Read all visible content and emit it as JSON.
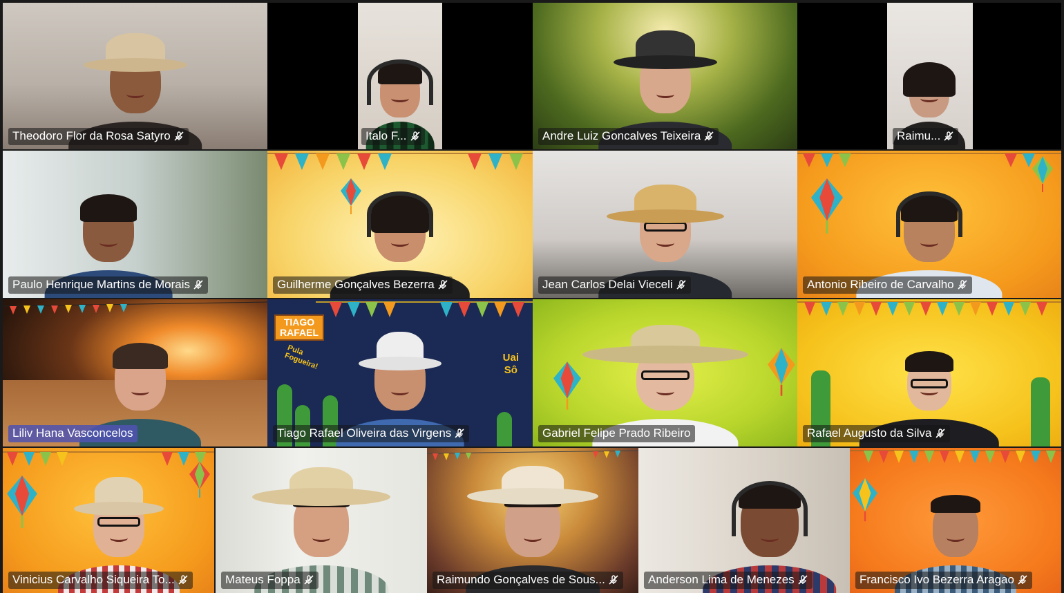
{
  "meeting": {
    "participants": [
      {
        "name": "Theodoro Flor da Rosa Satyro",
        "muted": true,
        "speaking": false
      },
      {
        "name": "Italo F...",
        "muted": true,
        "speaking": false
      },
      {
        "name": "Andre Luiz Goncalves Teixeira",
        "muted": true,
        "speaking": false
      },
      {
        "name": "Raimu...",
        "muted": true,
        "speaking": false
      },
      {
        "name": "Paulo Henrique Martins de Morais",
        "muted": true,
        "speaking": false
      },
      {
        "name": "Guilherme Gonçalves Bezerra",
        "muted": true,
        "speaking": false
      },
      {
        "name": "Jean Carlos Delai Vieceli",
        "muted": true,
        "speaking": false
      },
      {
        "name": "Antonio Ribeiro de Carvalho",
        "muted": true,
        "speaking": false
      },
      {
        "name": "Liliv Hana Vasconcelos",
        "muted": false,
        "speaking": true
      },
      {
        "name": "Tiago Rafael Oliveira das Virgens",
        "muted": true,
        "speaking": false
      },
      {
        "name": "Gabriel Felipe Prado Ribeiro",
        "muted": false,
        "speaking": false
      },
      {
        "name": "Rafael Augusto da Silva",
        "muted": true,
        "speaking": false
      },
      {
        "name": "Vinicius Carvalho Siqueira To...",
        "muted": true,
        "speaking": false
      },
      {
        "name": "Mateus Foppa",
        "muted": true,
        "speaking": false
      },
      {
        "name": "Raimundo Gonçalves de Sous...",
        "muted": true,
        "speaking": false
      },
      {
        "name": "Anderson Lima de Menezes",
        "muted": true,
        "speaking": false
      },
      {
        "name": "Francisco Ivo Bezerra Aragao",
        "muted": true,
        "speaking": false
      }
    ],
    "background_signs": {
      "tiago_top": "TIAGO",
      "tiago_bottom": "RAFAEL",
      "pula": "Pula",
      "fogueira": "Fogueira!",
      "uai": "Uai",
      "so": "Sô"
    }
  },
  "colors": {
    "speaking_tag": "#4f52b2",
    "name_tag_bg": "#141414",
    "festa_orange": "#f39a1e",
    "festa_yellow": "#f6c21c",
    "navy_bg": "#1b2a55"
  },
  "icons": {
    "muted": "mic-off-icon"
  }
}
